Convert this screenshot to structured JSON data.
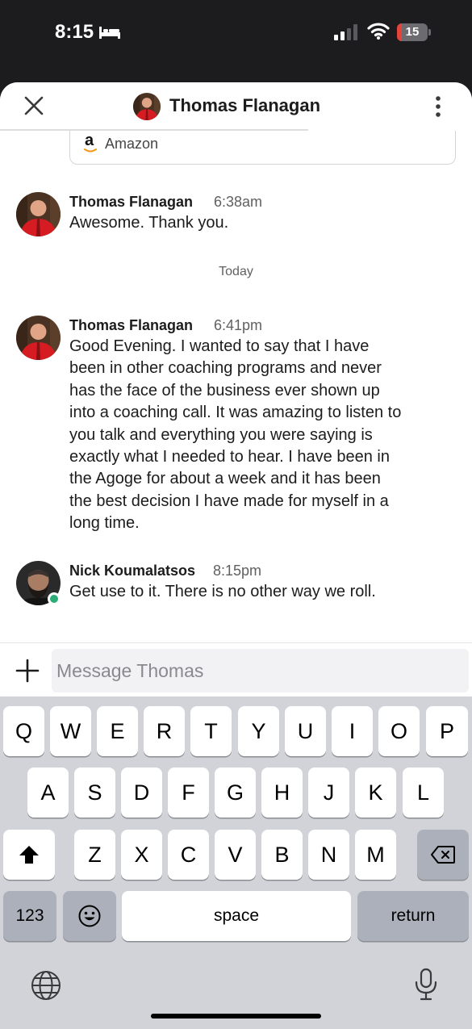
{
  "status_bar": {
    "time": "8:15",
    "battery_level": "15",
    "battery_fraction": 0.15,
    "icons": [
      "bed-icon",
      "cellular-signal-icon",
      "wifi-icon",
      "battery-icon"
    ]
  },
  "header": {
    "title": "Thomas Flanagan",
    "close_icon": "close-icon",
    "more_icon": "more-vertical-icon"
  },
  "link_preview": {
    "logo_text": "a",
    "label": "Amazon"
  },
  "messages": [
    {
      "author": "Thomas Flanagan",
      "time": "6:38am",
      "lines": [
        "Awesome. Thank you."
      ]
    },
    {
      "author": "Thomas Flanagan",
      "time": "6:41pm",
      "lines": [
        "Good Evening.  I wanted to say that I have",
        "been in other coaching programs and never",
        "has the face of the business ever shown up",
        "into a coaching call.  It was amazing to listen to",
        "you talk and everything you were saying is",
        "exactly what I needed to hear.  I have been in",
        "the Agoge for about a week and it has been",
        "the best decision I have made for myself in a",
        "long time."
      ]
    },
    {
      "author": "Nick Koumalatsos",
      "time": "8:15pm",
      "lines": [
        "Get use to it. There is no other way we roll."
      ]
    }
  ],
  "date_divider": "Today",
  "composer": {
    "placeholder": "Message Thomas",
    "value": ""
  },
  "keyboard": {
    "row1": [
      "Q",
      "W",
      "E",
      "R",
      "T",
      "Y",
      "U",
      "I",
      "O",
      "P"
    ],
    "row2": [
      "A",
      "S",
      "D",
      "F",
      "G",
      "H",
      "J",
      "K",
      "L"
    ],
    "row3": [
      "Z",
      "X",
      "C",
      "V",
      "B",
      "N",
      "M"
    ],
    "numbers_label": "123",
    "space_label": "space",
    "return_label": "return"
  },
  "colors": {
    "online": "#2bac76",
    "battery_low": "#e5443a",
    "keyboard_bg": "#d1d3d9"
  }
}
